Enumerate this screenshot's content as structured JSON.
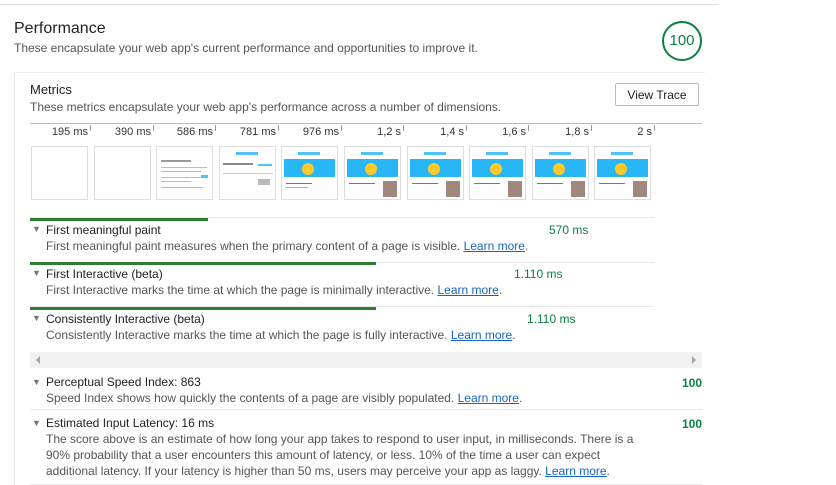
{
  "section": {
    "title": "Performance",
    "description": "These encapsulate your web app's current performance and opportunities to improve it.",
    "score": "100"
  },
  "metrics": {
    "title": "Metrics",
    "description": "These metrics encapsulate your web app's performance across a number of dimensions.",
    "view_trace_label": "View Trace"
  },
  "timeline": {
    "ticks": [
      "195 ms",
      "390 ms",
      "586 ms",
      "781 ms",
      "976 ms",
      "1,2 s",
      "1,4 s",
      "1,6 s",
      "1,8 s",
      "2 s"
    ]
  },
  "metric_rows": [
    {
      "name": "First meaningful paint",
      "description": "First meaningful paint measures when the primary content of a page is visible.",
      "learn_more": "Learn more",
      "value": "570 ms",
      "bar_fraction": 0.285
    },
    {
      "name": "First Interactive (beta)",
      "description": "First Interactive marks the time at which the page is minimally interactive.",
      "learn_more": "Learn more",
      "value": "1.110 ms",
      "bar_fraction": 0.555
    },
    {
      "name": "Consistently Interactive (beta)",
      "description": "Consistently Interactive marks the time at which the page is fully interactive.",
      "learn_more": "Learn more",
      "value": "1.110 ms",
      "bar_fraction": 0.555
    }
  ],
  "lower_rows": [
    {
      "name": "Perceptual Speed Index: 863",
      "description": "Speed Index shows how quickly the contents of a page are visibly populated.",
      "learn_more": "Learn more",
      "score": "100"
    },
    {
      "name": "Estimated Input Latency: 16 ms",
      "description_line1": "The score above is an estimate of how long your app takes to respond to user input, in milliseconds. There is a",
      "description_line2": "90% probability that a user encounters this amount of latency, or less. 10% of the time a user can expect",
      "description_line3": "additional latency. If your latency is higher than 50 ms, users may perceive your app as laggy.",
      "learn_more": "Learn more",
      "score": "100"
    }
  ],
  "icons": {
    "expand": "triangle-down-icon",
    "scroll_left": "scroll-left-arrow-icon",
    "scroll_right": "scroll-right-arrow-icon"
  }
}
